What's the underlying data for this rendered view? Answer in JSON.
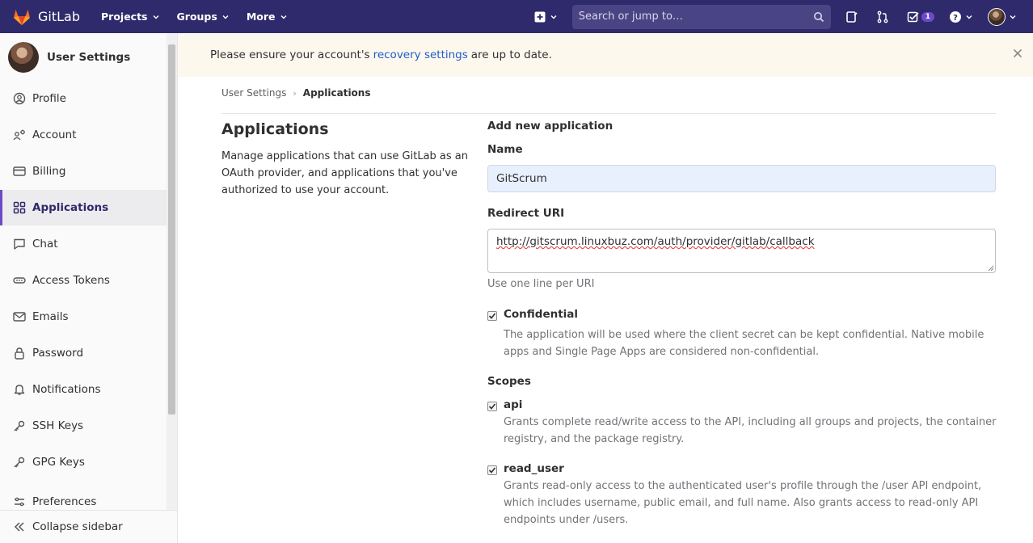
{
  "navbar": {
    "brand": "GitLab",
    "links": [
      {
        "label": "Projects"
      },
      {
        "label": "Groups"
      },
      {
        "label": "More"
      }
    ],
    "search_placeholder": "Search or jump to…",
    "todo_count": "1",
    "colors": {
      "bg": "#2f2a6b",
      "search_bg": "#4a4484",
      "accent": "#6e49cb",
      "logo": "#fc6d26"
    }
  },
  "sidebar": {
    "title": "User Settings",
    "items": [
      {
        "label": "Profile",
        "icon": "profile-icon"
      },
      {
        "label": "Account",
        "icon": "account-icon"
      },
      {
        "label": "Billing",
        "icon": "billing-icon"
      },
      {
        "label": "Applications",
        "icon": "applications-icon",
        "active": true
      },
      {
        "label": "Chat",
        "icon": "chat-icon"
      },
      {
        "label": "Access Tokens",
        "icon": "access-tokens-icon"
      },
      {
        "label": "Emails",
        "icon": "email-icon"
      },
      {
        "label": "Password",
        "icon": "lock-icon"
      },
      {
        "label": "Notifications",
        "icon": "bell-icon"
      },
      {
        "label": "SSH Keys",
        "icon": "key-icon"
      },
      {
        "label": "GPG Keys",
        "icon": "key-icon"
      },
      {
        "label": "Preferences",
        "icon": "preferences-icon"
      }
    ],
    "collapse_label": "Collapse sidebar"
  },
  "alert": {
    "before": "Please ensure your account's",
    "link": "recovery settings",
    "after": "are up to date."
  },
  "breadcrumb": {
    "parent": "User Settings",
    "current": "Applications"
  },
  "section": {
    "title": "Applications",
    "description": "Manage applications that can use GitLab as an OAuth provider, and applications that you've authorized to use your account."
  },
  "form": {
    "heading": "Add new application",
    "name_label": "Name",
    "name_value": "GitScrum",
    "redirect_label": "Redirect URI",
    "redirect_value": "http://gitscrum.linuxbuz.com/auth/provider/gitlab/callback",
    "redirect_help": "Use one line per URI",
    "confidential_label": "Confidential",
    "confidential_checked": true,
    "confidential_desc": "The application will be used where the client secret can be kept confidential. Native mobile apps and Single Page Apps are considered non-confidential.",
    "scopes_label": "Scopes",
    "scopes": [
      {
        "name": "api",
        "checked": true,
        "desc": "Grants complete read/write access to the API, including all groups and projects, the container registry, and the package registry."
      },
      {
        "name": "read_user",
        "checked": true,
        "desc": "Grants read-only access to the authenticated user's profile through the /user API endpoint, which includes username, public email, and full name. Also grants access to read-only API endpoints under /users."
      }
    ]
  }
}
